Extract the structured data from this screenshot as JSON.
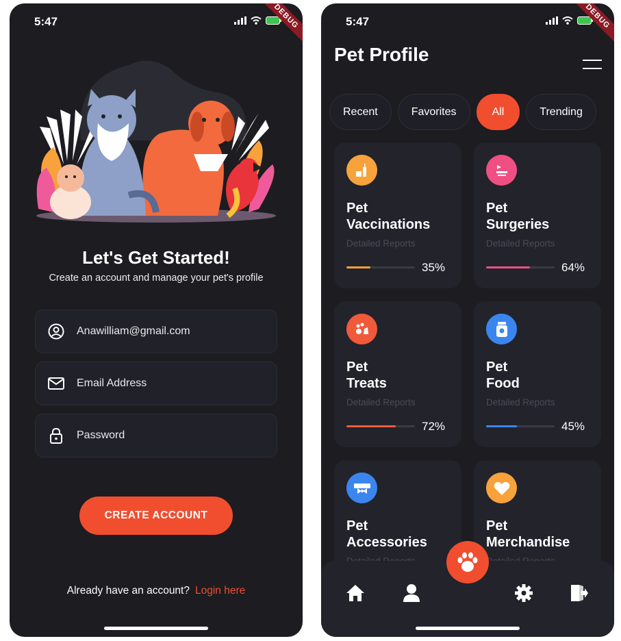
{
  "status": {
    "time": "5:47",
    "debug_label": "DEBUG"
  },
  "signup": {
    "title": "Let's Get Started!",
    "subtitle": "Create an account and manage your pet's profile",
    "fields": [
      {
        "icon": "user-circle-icon",
        "value": "Anawilliam@gmail.com"
      },
      {
        "icon": "envelope-icon",
        "placeholder": "Email Address"
      },
      {
        "icon": "lock-icon",
        "placeholder": "Password"
      }
    ],
    "cta_label": "CREATE ACCOUNT",
    "login_prompt": "Already have an account?",
    "login_link": "Login here"
  },
  "profile": {
    "title": "Pet Profile",
    "tabs": [
      "Recent",
      "Favorites",
      "All",
      "Trending"
    ],
    "active_tab": "All",
    "cards": [
      {
        "title_line1": "Pet",
        "title_line2": "Vaccinations",
        "subtitle": "Detailed Reports",
        "percent_label": "35%",
        "progress": 0.35,
        "color": "#f7a23b",
        "icon": "syringe-icon"
      },
      {
        "title_line1": "Pet",
        "title_line2": "Surgeries",
        "subtitle": "Detailed Reports",
        "percent_label": "64%",
        "progress": 0.64,
        "color": "#ef4f82",
        "icon": "surgery-bed-icon"
      },
      {
        "title_line1": "Pet",
        "title_line2": "Treats",
        "subtitle": "Detailed Reports",
        "percent_label": "72%",
        "progress": 0.72,
        "color": "#f05a3a",
        "icon": "treats-icon"
      },
      {
        "title_line1": "Pet",
        "title_line2": "Food",
        "subtitle": "Detailed Reports",
        "percent_label": "45%",
        "progress": 0.45,
        "color": "#3b86ee",
        "icon": "food-jar-icon"
      },
      {
        "title_line1": "Pet",
        "title_line2": "Accessories",
        "subtitle": "Detailed Reports",
        "color": "#3b86ee",
        "icon": "bowtie-icon"
      },
      {
        "title_line1": "Pet",
        "title_line2": "Merchandise",
        "subtitle": "Detailed Reports",
        "color": "#f7a23b",
        "icon": "heart-icon"
      }
    ],
    "nav": [
      "home-icon",
      "profile-icon",
      "paw-icon",
      "settings-icon",
      "logout-icon"
    ]
  },
  "colors": {
    "accent": "#f04e2f",
    "background": "#1c1c21",
    "card": "#22232b"
  }
}
